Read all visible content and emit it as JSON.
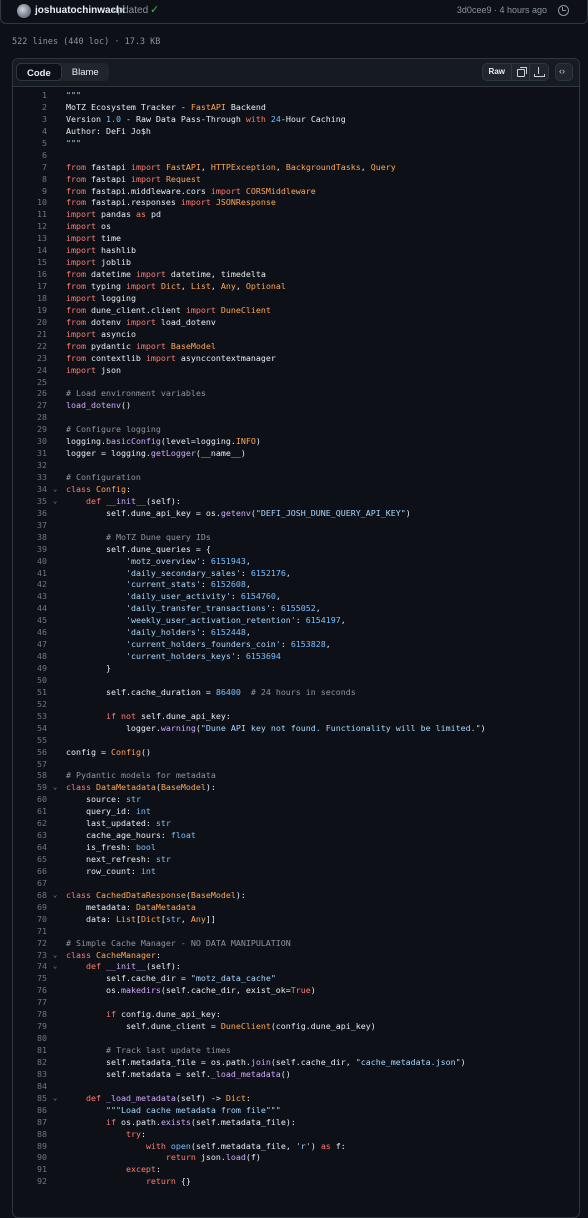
{
  "commit": {
    "author": "joshuatochinwachi",
    "message": "updated",
    "hash_time": "3d0cee9 · 4 hours ago"
  },
  "file_info": "522 lines (440 loc) · 17.3 KB",
  "toolbar": {
    "code_tab": "Code",
    "blame_tab": "Blame",
    "raw_button": "Raw"
  },
  "code_lines": [
    {
      "n": "1",
      "t": "\"\"\""
    },
    {
      "n": "2",
      "t": "MoTZ Ecosystem Tracker - FastAPI Backend"
    },
    {
      "n": "3",
      "t": "Version 1.0 - Raw Data Pass-Through with 24-Hour Caching"
    },
    {
      "n": "4",
      "t": "Author: DeFi Jo$h"
    },
    {
      "n": "5",
      "t": "\"\"\""
    },
    {
      "n": "6",
      "t": ""
    },
    {
      "n": "7",
      "t": "from fastapi import FastAPI, HTTPException, BackgroundTasks, Query"
    },
    {
      "n": "8",
      "t": "from fastapi import Request"
    },
    {
      "n": "9",
      "t": "from fastapi.middleware.cors import CORSMiddleware"
    },
    {
      "n": "10",
      "t": "from fastapi.responses import JSONResponse"
    },
    {
      "n": "11",
      "t": "import pandas as pd"
    },
    {
      "n": "12",
      "t": "import os"
    },
    {
      "n": "13",
      "t": "import time"
    },
    {
      "n": "14",
      "t": "import hashlib"
    },
    {
      "n": "15",
      "t": "import joblib"
    },
    {
      "n": "16",
      "t": "from datetime import datetime, timedelta"
    },
    {
      "n": "17",
      "t": "from typing import Dict, List, Any, Optional"
    },
    {
      "n": "18",
      "t": "import logging"
    },
    {
      "n": "19",
      "t": "from dune_client.client import DuneClient"
    },
    {
      "n": "20",
      "t": "from dotenv import load_dotenv"
    },
    {
      "n": "21",
      "t": "import asyncio"
    },
    {
      "n": "22",
      "t": "from pydantic import BaseModel"
    },
    {
      "n": "23",
      "t": "from contextlib import asynccontextmanager"
    },
    {
      "n": "24",
      "t": "import json"
    },
    {
      "n": "25",
      "t": ""
    },
    {
      "n": "26",
      "t": "# Load environment variables"
    },
    {
      "n": "27",
      "t": "load_dotenv()"
    },
    {
      "n": "28",
      "t": ""
    },
    {
      "n": "29",
      "t": "# Configure logging"
    },
    {
      "n": "30",
      "t": "logging.basicConfig(level=logging.INFO)"
    },
    {
      "n": "31",
      "t": "logger = logging.getLogger(__name__)"
    },
    {
      "n": "32",
      "t": ""
    },
    {
      "n": "33",
      "t": "# Configuration"
    },
    {
      "n": "34",
      "t": "class Config:"
    },
    {
      "n": "35",
      "t": "    def __init__(self):"
    },
    {
      "n": "36",
      "t": "        self.dune_api_key = os.getenv(\"DEFI_JOSH_DUNE_QUERY_API_KEY\")"
    },
    {
      "n": "37",
      "t": ""
    },
    {
      "n": "38",
      "t": "        # MoTZ Dune query IDs"
    },
    {
      "n": "39",
      "t": "        self.dune_queries = {"
    },
    {
      "n": "40",
      "t": "            'motz_overview': 6151943,"
    },
    {
      "n": "41",
      "t": "            'daily_secondary_sales': 6152176,"
    },
    {
      "n": "42",
      "t": "            'current_stats': 6152608,"
    },
    {
      "n": "43",
      "t": "            'daily_user_activity': 6154760,"
    },
    {
      "n": "44",
      "t": "            'daily_transfer_transactions': 6155052,"
    },
    {
      "n": "45",
      "t": "            'weekly_user_activation_retention': 6154197,"
    },
    {
      "n": "46",
      "t": "            'daily_holders': 6152448,"
    },
    {
      "n": "47",
      "t": "            'current_holders_founders_coin': 6153828,"
    },
    {
      "n": "48",
      "t": "            'current_holders_keys': 6153694"
    },
    {
      "n": "49",
      "t": "        }"
    },
    {
      "n": "50",
      "t": ""
    },
    {
      "n": "51",
      "t": "        self.cache_duration = 86400  # 24 hours in seconds"
    },
    {
      "n": "52",
      "t": ""
    },
    {
      "n": "53",
      "t": "        if not self.dune_api_key:"
    },
    {
      "n": "54",
      "t": "            logger.warning(\"Dune API key not found. Functionality will be limited.\")"
    },
    {
      "n": "55",
      "t": ""
    },
    {
      "n": "56",
      "t": "config = Config()"
    },
    {
      "n": "57",
      "t": ""
    },
    {
      "n": "58",
      "t": "# Pydantic models for metadata"
    },
    {
      "n": "59",
      "t": "class DataMetadata(BaseModel):"
    },
    {
      "n": "60",
      "t": "    source: str"
    },
    {
      "n": "61",
      "t": "    query_id: int"
    },
    {
      "n": "62",
      "t": "    last_updated: str"
    },
    {
      "n": "63",
      "t": "    cache_age_hours: float"
    },
    {
      "n": "64",
      "t": "    is_fresh: bool"
    },
    {
      "n": "65",
      "t": "    next_refresh: str"
    },
    {
      "n": "66",
      "t": "    row_count: int"
    },
    {
      "n": "67",
      "t": ""
    },
    {
      "n": "68",
      "t": "class CachedDataResponse(BaseModel):"
    },
    {
      "n": "69",
      "t": "    metadata: DataMetadata"
    },
    {
      "n": "70",
      "t": "    data: List[Dict[str, Any]]"
    },
    {
      "n": "71",
      "t": ""
    },
    {
      "n": "72",
      "t": "# Simple Cache Manager - NO DATA MANIPULATION"
    },
    {
      "n": "73",
      "t": "class CacheManager:"
    },
    {
      "n": "74",
      "t": "    def __init__(self):"
    },
    {
      "n": "75",
      "t": "        self.cache_dir = \"motz_data_cache\""
    },
    {
      "n": "76",
      "t": "        os.makedirs(self.cache_dir, exist_ok=True)"
    },
    {
      "n": "77",
      "t": ""
    },
    {
      "n": "78",
      "t": "        if config.dune_api_key:"
    },
    {
      "n": "79",
      "t": "            self.dune_client = DuneClient(config.dune_api_key)"
    },
    {
      "n": "80",
      "t": ""
    },
    {
      "n": "81",
      "t": "        # Track last update times"
    },
    {
      "n": "82",
      "t": "        self.metadata_file = os.path.join(self.cache_dir, \"cache_metadata.json\")"
    },
    {
      "n": "83",
      "t": "        self.metadata = self._load_metadata()"
    },
    {
      "n": "84",
      "t": ""
    },
    {
      "n": "85",
      "t": "    def _load_metadata(self) -> Dict:"
    },
    {
      "n": "86",
      "t": "        \"\"\"Load cache metadata from file\"\"\""
    },
    {
      "n": "87",
      "t": "        if os.path.exists(self.metadata_file):"
    },
    {
      "n": "88",
      "t": "            try:"
    },
    {
      "n": "89",
      "t": "                with open(self.metadata_file, 'r') as f:"
    },
    {
      "n": "90",
      "t": "                    return json.load(f)"
    },
    {
      "n": "91",
      "t": "            except:"
    },
    {
      "n": "92",
      "t": "                return {}"
    }
  ]
}
